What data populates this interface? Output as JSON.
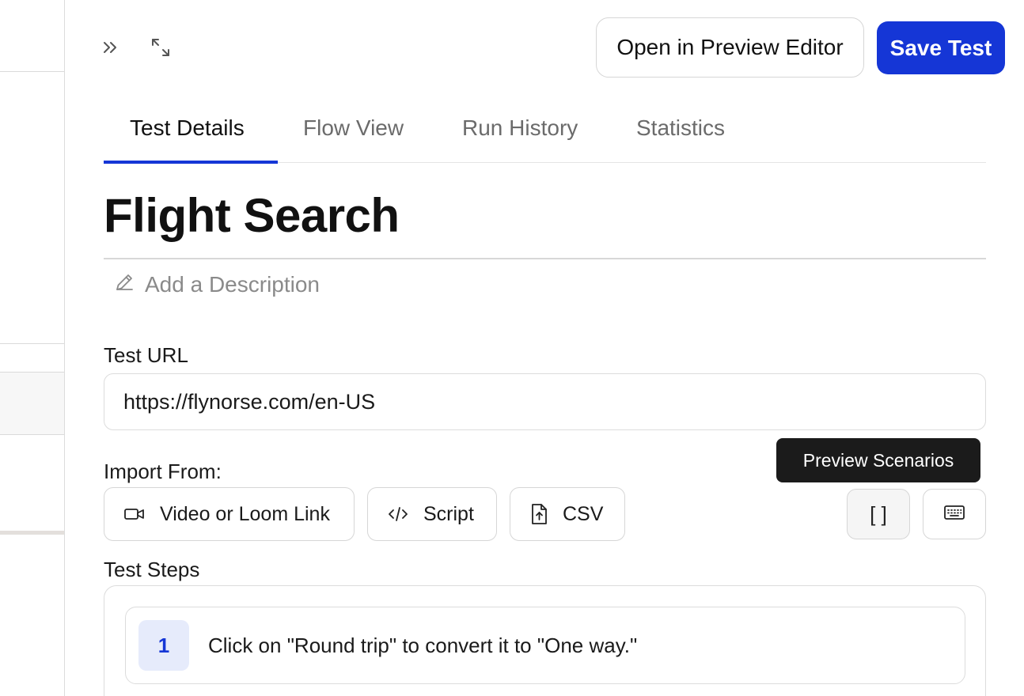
{
  "header": {
    "open_editor_label": "Open in Preview Editor",
    "save_label": "Save Test",
    "icons": [
      "double-chevron-right-icon",
      "expand-icon"
    ]
  },
  "tabs": [
    {
      "label": "Test Details",
      "active": true
    },
    {
      "label": "Flow View",
      "active": false
    },
    {
      "label": "Run History",
      "active": false
    },
    {
      "label": "Statistics",
      "active": false
    }
  ],
  "test": {
    "title": "Flight Search",
    "description_placeholder": "Add a Description",
    "url_label": "Test URL",
    "url_value": "https://flynorse.com/en-US"
  },
  "import": {
    "label": "Import From:",
    "buttons": [
      {
        "label": "Video or Loom Link",
        "icon": "video-camera-icon"
      },
      {
        "label": "Script",
        "icon": "code-icon"
      },
      {
        "label": "CSV",
        "icon": "file-upload-icon"
      }
    ],
    "scenarios_button_text": "[ ]",
    "keyboard_icon": "keyboard-icon",
    "tooltip": "Preview Scenarios"
  },
  "steps": {
    "label": "Test Steps",
    "items": [
      {
        "number": "1",
        "text": "Click on \"Round trip\" to convert it to \"One way.\""
      }
    ]
  },
  "colors": {
    "primary": "#1536d6",
    "step_badge_bg": "#e6ebfb",
    "tooltip_bg": "#1b1b1b"
  }
}
